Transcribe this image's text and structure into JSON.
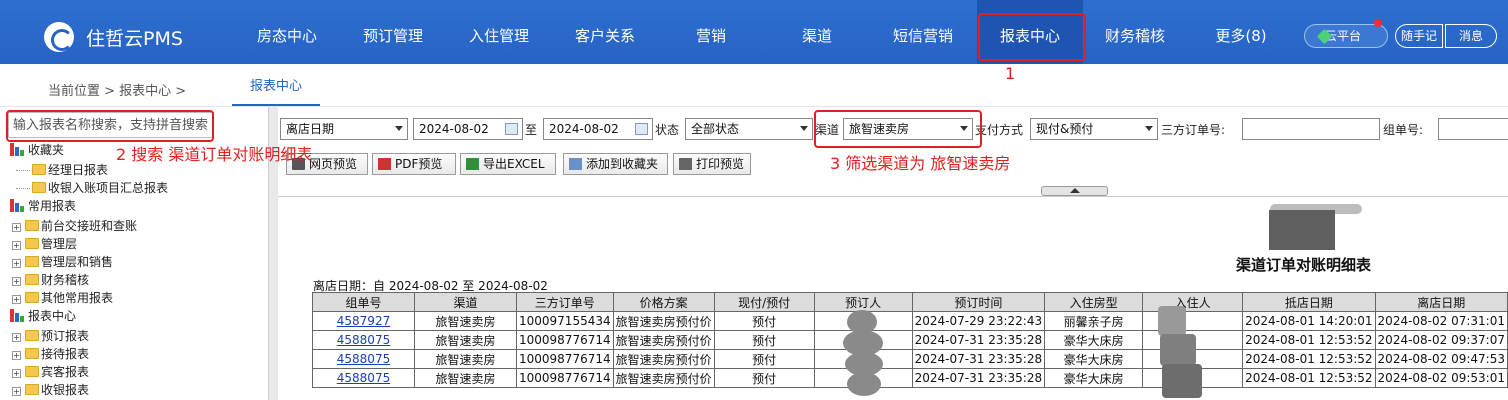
{
  "app": {
    "name": "住哲云PMS"
  },
  "nav": {
    "items": [
      "房态中心",
      "预订管理",
      "入住管理",
      "客户关系",
      "营销",
      "渠道",
      "短信营销",
      "报表中心",
      "财务稽核",
      "更多(8)"
    ],
    "cloud": "云平台",
    "note": "随手记",
    "message": "消息"
  },
  "breadcrumb": "当前位置 > 报表中心 >",
  "tab": "报表中心",
  "sidebar": {
    "search_placeholder": "输入报表名称搜索，支持拼音搜索",
    "groups": [
      {
        "label": "收藏夹",
        "children": [
          "经理日报表",
          "收银入账项目汇总报表"
        ]
      },
      {
        "label": "常用报表",
        "children": [
          "前台交接班和查账",
          "管理层",
          "管理层和销售",
          "财务稽核",
          "其他常用报表"
        ]
      },
      {
        "label": "报表中心",
        "children": [
          "预订报表",
          "接待报表",
          "宾客报表",
          "收银报表"
        ]
      }
    ]
  },
  "filters": {
    "date_type": "离店日期",
    "date_from": "2024-08-02",
    "to_label": "至",
    "date_to": "2024-08-02",
    "status_label": "状态",
    "status": "全部状态",
    "channel_label": "渠道",
    "channel": "旅智速卖房",
    "pay_label": "支付方式",
    "pay": "现付&预付",
    "third_order_label": "三方订单号:",
    "group_label": "组单号:"
  },
  "toolbar": {
    "web_preview": "网页预览",
    "pdf_preview": "PDF预览",
    "export_excel": "导出EXCEL",
    "add_favorite": "添加到收藏夹",
    "print_preview": "打印预览"
  },
  "report": {
    "title": "渠道订单对账明细表",
    "date_range": "离店日期：自 2024-08-02 至 2024-08-02",
    "columns": [
      "组单号",
      "渠道",
      "三方订单号",
      "价格方案",
      "现付/预付",
      "预订人",
      "预订时间",
      "入住房型",
      "入住人",
      "抵店日期",
      "离店日期"
    ],
    "rows": [
      [
        "4587927",
        "旅智速卖房",
        "100097155434",
        "旅智速卖房预付价",
        "预付",
        "",
        "2024-07-29 23:22:43",
        "丽馨亲子房",
        "",
        "2024-08-01 14:20:01",
        "2024-08-02 07:31:01"
      ],
      [
        "4588075",
        "旅智速卖房",
        "100098776714",
        "旅智速卖房预付价",
        "预付",
        "",
        "2024-07-31 23:35:28",
        "豪华大床房",
        "",
        "2024-08-01 12:53:52",
        "2024-08-02 09:37:07"
      ],
      [
        "4588075",
        "旅智速卖房",
        "100098776714",
        "旅智速卖房预付价",
        "预付",
        "",
        "2024-07-31 23:35:28",
        "豪华大床房",
        "",
        "2024-08-01 12:53:52",
        "2024-08-02 09:47:53"
      ],
      [
        "4588075",
        "旅智速卖房",
        "100098776714",
        "旅智速卖房预付价",
        "预付",
        "",
        "2024-07-31 23:35:28",
        "豪华大床房",
        "",
        "2024-08-01 12:53:52",
        "2024-08-02 09:53:01"
      ]
    ]
  },
  "annotations": {
    "step1": "1",
    "step2": "2 搜索 渠道订单对账明细表",
    "step3": "3 筛选渠道为 旅智速卖房"
  },
  "colors": {
    "nav_bg": "#2563c4",
    "annotation": "#e02020",
    "link": "#1a3fb0"
  }
}
